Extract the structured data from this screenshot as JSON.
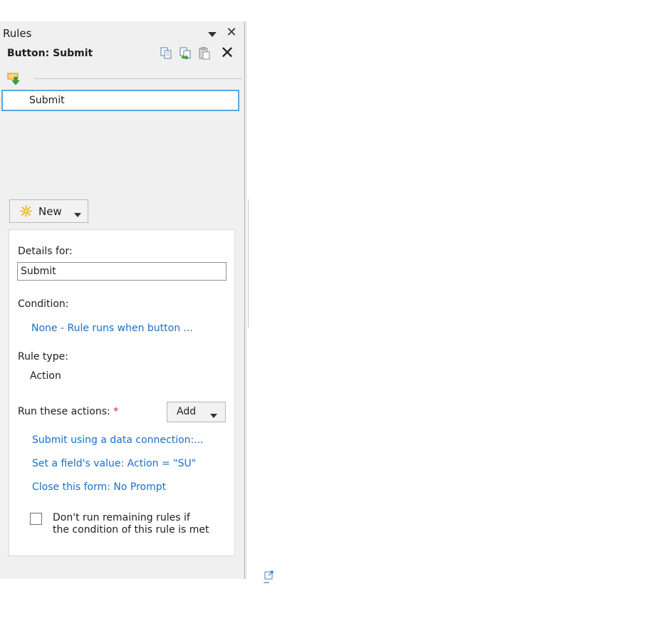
{
  "pane": {
    "title": "Rules",
    "close_glyph": "✕",
    "menu_icon": "dropdown-arrow-icon"
  },
  "control": {
    "name": "Button: Submit",
    "toolbar": [
      "copy-icon",
      "copy-rule-icon",
      "paste-icon",
      "delete-icon"
    ],
    "delete_glyph": "✕"
  },
  "rules": {
    "items": [
      {
        "label": "Submit",
        "selected": true
      }
    ]
  },
  "new_button": {
    "label": "New"
  },
  "details": {
    "heading": "Details for:",
    "name_value": "Submit",
    "condition_label": "Condition:",
    "condition_value": "None - Rule runs when button ...",
    "rule_type_label": "Rule type:",
    "rule_type_value": "Action",
    "actions_label": "Run these actions:",
    "required_mark": "*",
    "add_label": "Add",
    "actions": [
      "Submit using a data connection:...",
      "Set a field's value: Action = \"SU\"",
      "Close this form: No Prompt"
    ],
    "stop_checkbox": {
      "checked": false,
      "line1": "Don't run remaining rules if",
      "line2": "the condition of this rule is met"
    }
  },
  "colors": {
    "link": "#1a6fc9",
    "selection_border": "#5ba7e2",
    "pane_bg": "#f0f0f0",
    "required": "#d02020"
  }
}
